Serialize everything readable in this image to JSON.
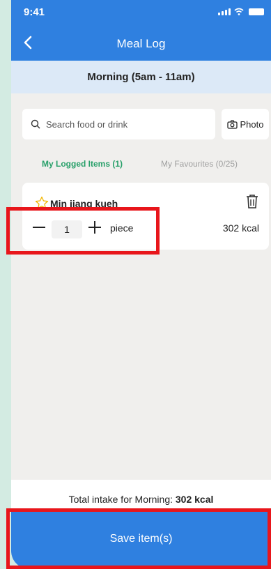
{
  "status": {
    "time": "9:41"
  },
  "header": {
    "title": "Meal Log"
  },
  "period": {
    "label": "Morning (5am - 11am)"
  },
  "search": {
    "placeholder": "Search food or drink",
    "photo_label": "Photo"
  },
  "tabs": [
    {
      "label": "My Logged Items (1)",
      "active": true
    },
    {
      "label": "My Favourites (0/25)",
      "active": false
    }
  ],
  "items": [
    {
      "name": "Min jiang kueh",
      "quantity": "1",
      "unit": "piece",
      "kcal": "302 kcal",
      "favourite": false
    }
  ],
  "footer": {
    "total_label": "Total intake for Morning:",
    "total_value": "302 kcal"
  },
  "save": {
    "label": "Save item(s)"
  },
  "colors": {
    "primary": "#2f80e0",
    "tab_active": "#28a06a",
    "highlight": "#e8161b",
    "background": "#f0efed",
    "side": "#d3ebe2"
  }
}
